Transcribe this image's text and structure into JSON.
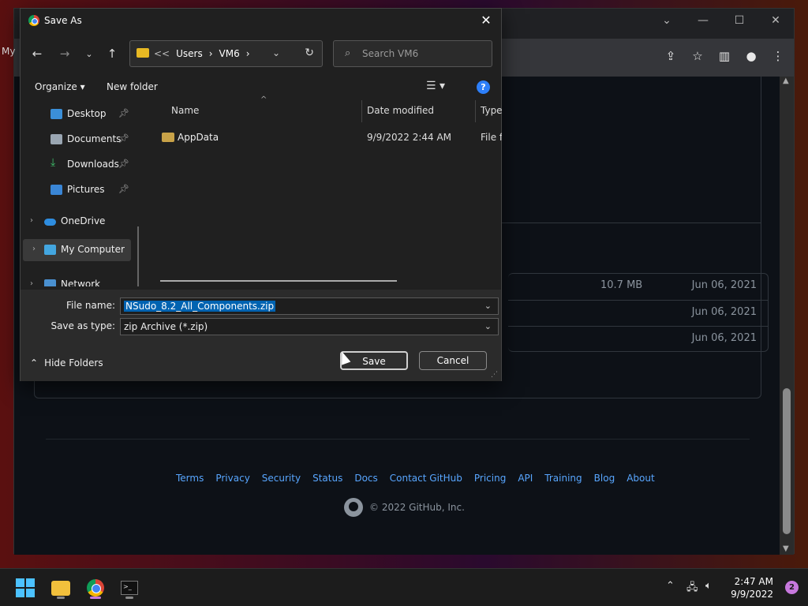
{
  "browser": {
    "left_tab_fragment": "My",
    "github_assets": [
      {
        "size": "10.7 MB",
        "date": "Jun 06, 2021"
      },
      {
        "size": "",
        "date": "Jun 06, 2021"
      },
      {
        "size": "",
        "date": "Jun 06, 2021"
      }
    ],
    "footer_links": [
      "Terms",
      "Privacy",
      "Security",
      "Status",
      "Docs",
      "Contact GitHub",
      "Pricing",
      "API",
      "Training",
      "Blog",
      "About"
    ],
    "copyright": "© 2022 GitHub, Inc."
  },
  "dialog": {
    "title": "Save As",
    "breadcrumb": {
      "prefix": "<<",
      "items": [
        "Users",
        "VM6"
      ]
    },
    "search_placeholder": "Search VM6",
    "organize_label": "Organize",
    "new_folder_label": "New folder",
    "nav_items": [
      {
        "label": "Desktop",
        "pinned": true
      },
      {
        "label": "Documents",
        "pinned": true
      },
      {
        "label": "Downloads",
        "pinned": true
      },
      {
        "label": "Pictures",
        "pinned": true
      },
      {
        "label": "OneDrive",
        "pinned": false
      },
      {
        "label": "My Computer",
        "pinned": false,
        "selected": true
      },
      {
        "label": "Network",
        "pinned": false
      }
    ],
    "columns": {
      "name": "Name",
      "date_modified": "Date modified",
      "type": "Type"
    },
    "files": [
      {
        "name": "AppData",
        "date_modified": "9/9/2022 2:44 AM",
        "type": "File folder"
      }
    ],
    "file_name_label": "File name:",
    "file_name_value": "NSudo_8.2_All_Components.zip",
    "save_type_label": "Save as type:",
    "save_type_value": "zip Archive (*.zip)",
    "hide_folders_label": "Hide Folders",
    "save_label": "Save",
    "cancel_label": "Cancel"
  },
  "taskbar": {
    "time": "2:47 AM",
    "date": "9/9/2022",
    "notification_count": "2"
  },
  "colors": {
    "accent_blue": "#0063b1",
    "github_link": "#58a6ff",
    "dialog_bg": "#202020"
  }
}
